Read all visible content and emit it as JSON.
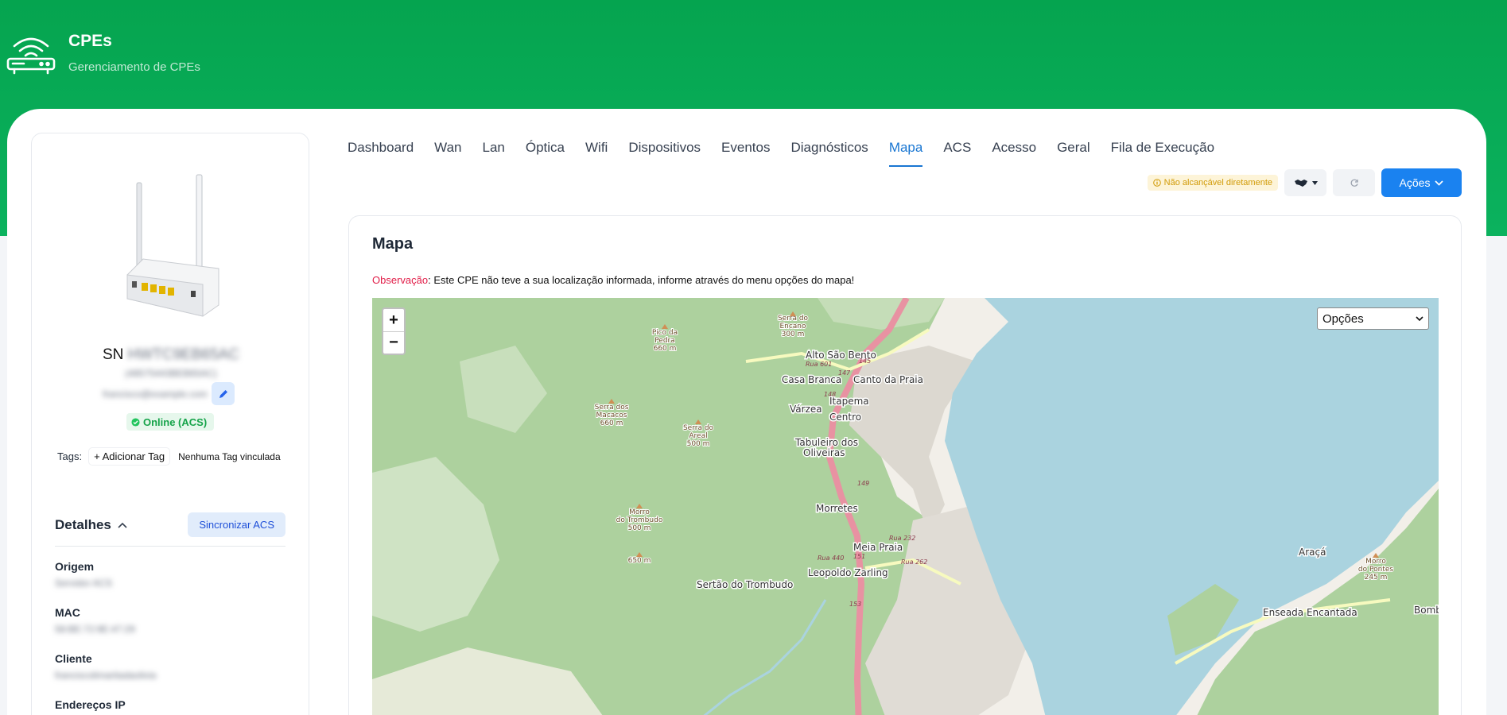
{
  "header": {
    "title": "CPEs",
    "subtitle": "Gerenciamento de CPEs",
    "icon": "router-wifi-icon"
  },
  "device": {
    "sn_prefix": "SN",
    "sn_value": "HWTC9EB65AC",
    "sub_id": "(48575443BEB65AC)",
    "hostname": "francisco@example.com",
    "status": "Online (ACS)",
    "tags_label": "Tags:",
    "add_tag": "+ Adicionar Tag",
    "no_tag": "Nenhuma Tag vinculada"
  },
  "details": {
    "title": "Detalhes",
    "sync_button": "Sincronizar ACS",
    "fields": [
      {
        "label": "Origem",
        "value": "Servidor ACS"
      },
      {
        "label": "MAC",
        "value": "58:BE:72:9E:47:29"
      },
      {
        "label": "Cliente",
        "value": "franciscolimaritadaolivia"
      },
      {
        "label": "Endereços IP",
        "value": ""
      }
    ]
  },
  "tabs": [
    "Dashboard",
    "Wan",
    "Lan",
    "Óptica",
    "Wifi",
    "Dispositivos",
    "Eventos",
    "Diagnósticos",
    "Mapa",
    "ACS",
    "Acesso",
    "Geral",
    "Fila de Execução"
  ],
  "active_tab": "Mapa",
  "toolbar": {
    "warning": "Não alcançável diretamente",
    "acoes": "Ações"
  },
  "map_section": {
    "title": "Mapa",
    "obs_key": "Observação",
    "obs_text": ": Este CPE não teve a sua localização informada, informe através do menu opções do mapa!",
    "options_select": "Opções",
    "zoom_in": "+",
    "zoom_out": "−"
  },
  "map_labels": {
    "l1": "Alto São Bento",
    "l2": "Casa Branca",
    "l3": "Canto da Praia",
    "l4": "Itapema",
    "l5": "Várzea",
    "l6": "Centro",
    "l7": "Tabuleiro dos",
    "l8": "Oliveiras",
    "l9": "Morretes",
    "l10": "Meia Praia",
    "l11": "Leopoldo Zarling",
    "l12": "Sertão do Trombudo",
    "l13": "Enseada Encantada",
    "l14": "Bombas",
    "l15": "Araçá",
    "p1": "Pico da",
    "p1b": "Pedra",
    "p1c": "660 m",
    "p2": "Serra do",
    "p2b": "Encano",
    "p2c": "300 m",
    "p3": "Serra dos",
    "p3b": "Macacos",
    "p3c": "660 m",
    "p4": "Serra do",
    "p4b": "Areal",
    "p4c": "500 m",
    "p5": "Morro",
    "p5b": "do Trombudo",
    "p5c": "500 m",
    "p6": "650 m",
    "p7": "Morro",
    "p7b": "do Pontes",
    "p7c": "245 m",
    "r1": "145",
    "r2": "147",
    "r3": "148",
    "r4": "149",
    "r5": "151",
    "r6": "153",
    "s1": "Rua 232",
    "s2": "Rua 262",
    "s3": "Rua 440",
    "s4": "Rua 601"
  },
  "colors": {
    "brand_green": "#05a44f",
    "active_blue": "#1976d2",
    "forest": "#aed0a0",
    "water": "#aad3df",
    "highway": "#e892a2"
  }
}
